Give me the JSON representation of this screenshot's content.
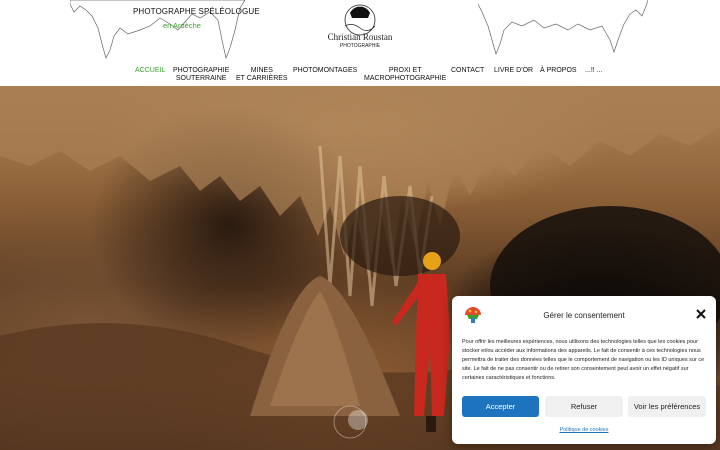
{
  "header": {
    "tagline": "PHOTOGRAPHE SPÉLÉOLOGUE",
    "tagline_sub": "en Ardèche",
    "logo_name": "Christian Roustan",
    "logo_sub": "PHOTOGRAPHIE"
  },
  "nav": {
    "items": [
      {
        "label_1": "ACCUEIL",
        "label_2": ""
      },
      {
        "label_1": "PHOTOGRAPHIE",
        "label_2": "SOUTERRAINE"
      },
      {
        "label_1": "MINES",
        "label_2": "ET CARRIÈRES"
      },
      {
        "label_1": "PHOTOMONTAGES",
        "label_2": ""
      },
      {
        "label_1": "PROXI ET",
        "label_2": "MACROPHOTOGRAPHIE"
      },
      {
        "label_1": "CONTACT",
        "label_2": ""
      },
      {
        "label_1": "LIVRE D'OR",
        "label_2": ""
      },
      {
        "label_1": "À PROPOS",
        "label_2": ""
      },
      {
        "label_1": "...!! ...",
        "label_2": ""
      }
    ],
    "active_color": "#3aa02c"
  },
  "cookie": {
    "title": "Gérer le consentement",
    "text": "Pour offrir les meilleures expériences, nous utilisons des technologies telles que les cookies pour stocker et/ou accéder aux informations des appareils. Le fait de consentir à ces technologies nous permettra de traiter des données telles que le comportement de navigation ou les ID uniques sur ce site. Le fait de ne pas consentir ou de retirer son consentement peut avoir un effet négatif sur certaines caractéristiques et fonctions.",
    "accept": "Accepter",
    "refuse": "Refuser",
    "prefs": "Voir les préférences",
    "policy_link": "Politique de cookies",
    "accent": "#1e73be"
  },
  "icons": [
    "close-icon",
    "cookie-logo-icon",
    "stalactite-decoration"
  ]
}
